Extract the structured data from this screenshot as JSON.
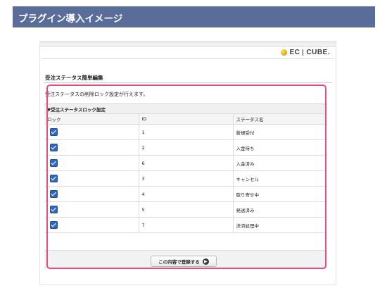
{
  "banner": {
    "title": "プラグイン導入イメージ"
  },
  "logo": {
    "text_left": "EC",
    "text_right": "CUBE."
  },
  "page": {
    "title": "受注ステータス簡単編集",
    "description": "受注ステータスの削除ロック設定が行えます。"
  },
  "table": {
    "caption": "▼受注ステータスロック設定",
    "headers": {
      "lock": "ロック",
      "id": "ID",
      "name": "ステータス名"
    },
    "rows": [
      {
        "locked": true,
        "id": "1",
        "name": "新規受付"
      },
      {
        "locked": true,
        "id": "2",
        "name": "入金待ち"
      },
      {
        "locked": true,
        "id": "6",
        "name": "入金済み"
      },
      {
        "locked": true,
        "id": "3",
        "name": "キャンセル"
      },
      {
        "locked": true,
        "id": "4",
        "name": "取り寄せ中"
      },
      {
        "locked": true,
        "id": "5",
        "name": "発送済み"
      },
      {
        "locked": true,
        "id": "7",
        "name": "決済処理中"
      }
    ]
  },
  "actions": {
    "register_label": "この内容で登録する"
  },
  "colors": {
    "banner": "#5a6d9a",
    "highlight": "#e64b86",
    "checkbox": "#2e67c4"
  }
}
